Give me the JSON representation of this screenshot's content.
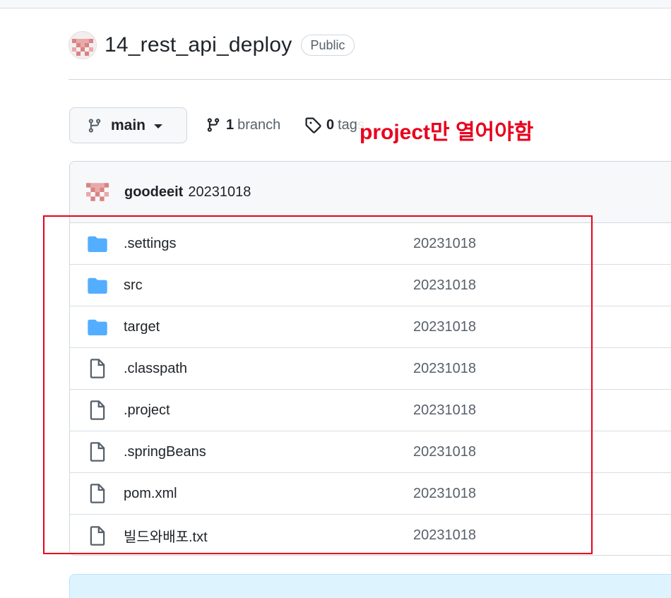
{
  "repo": {
    "name": "14_rest_api_deploy",
    "visibility": "Public"
  },
  "branch_selector": {
    "label": "main"
  },
  "stats": {
    "branch_count": "1",
    "branch_label": "branch",
    "tag_count": "0",
    "tag_label": "tags"
  },
  "annotation": {
    "text": "project만 열어야함",
    "color": "#e8001c"
  },
  "latest_commit": {
    "author": "goodeeit",
    "message": "20231018"
  },
  "files": [
    {
      "name": ".settings",
      "type": "folder",
      "commit": "20231018"
    },
    {
      "name": "src",
      "type": "folder",
      "commit": "20231018"
    },
    {
      "name": "target",
      "type": "folder",
      "commit": "20231018"
    },
    {
      "name": ".classpath",
      "type": "file",
      "commit": "20231018"
    },
    {
      "name": ".project",
      "type": "file",
      "commit": "20231018"
    },
    {
      "name": ".springBeans",
      "type": "file",
      "commit": "20231018"
    },
    {
      "name": "pom.xml",
      "type": "file",
      "commit": "20231018"
    },
    {
      "name": "빌드와배포.txt",
      "type": "file",
      "commit": "20231018"
    }
  ],
  "colors": {
    "folder": "#54aeff",
    "file_icon": "#57606a",
    "avatar": "#d98383"
  }
}
